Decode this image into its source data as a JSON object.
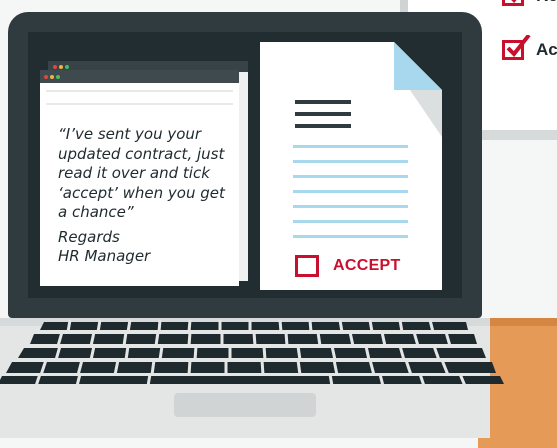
{
  "background_board": {
    "items": [
      {
        "label": "Re",
        "checked": true
      },
      {
        "label": "Ac",
        "checked": true
      }
    ]
  },
  "email": {
    "message": "“I’ve sent you your updated contract, just read it over and tick ‘accept’ when you get a chance”",
    "signoff": "Regards",
    "sender": "HR Manager"
  },
  "document": {
    "accept_label": "ACCEPT",
    "accept_checked": false
  },
  "colors": {
    "accent_red": "#c8102e",
    "doc_line_blue": "#a7d8ee",
    "laptop_dark": "#2f3b3f"
  }
}
